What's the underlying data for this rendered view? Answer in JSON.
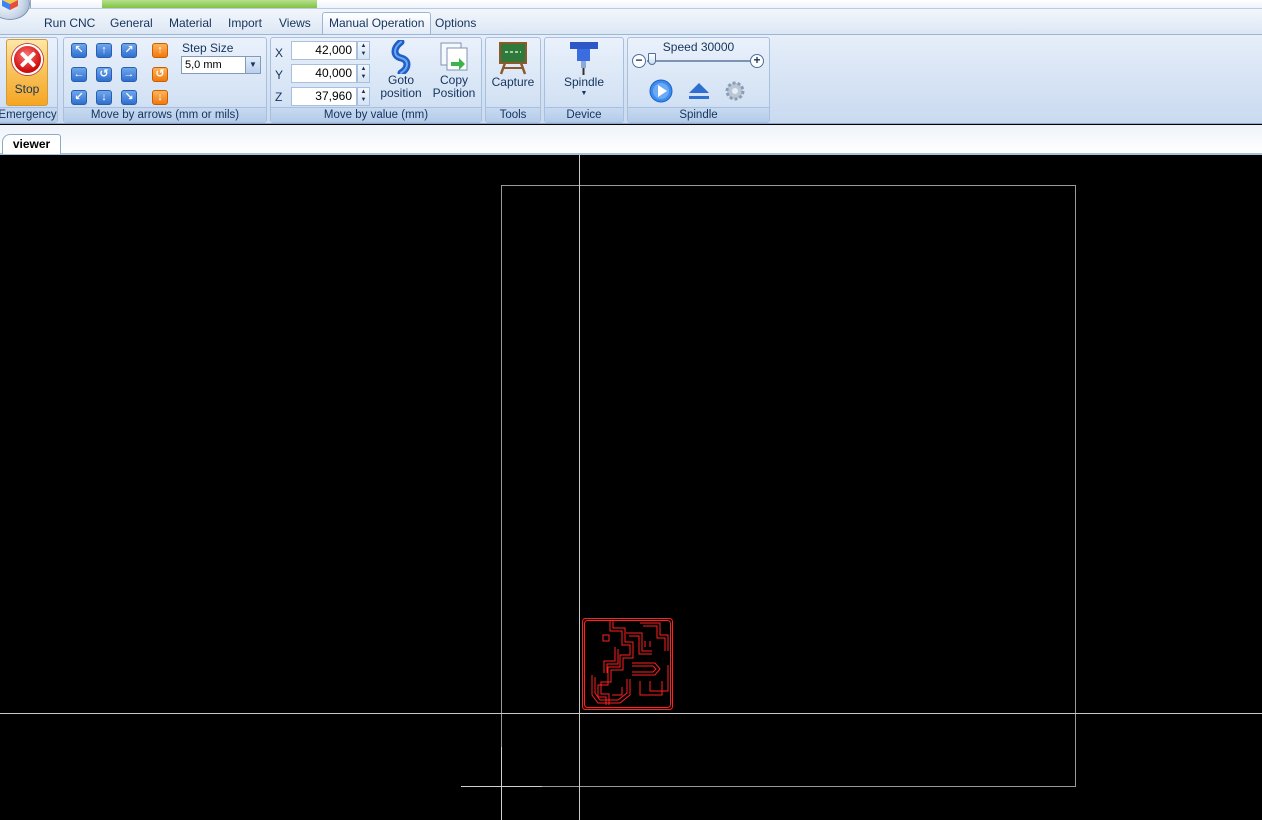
{
  "menu": {
    "tabs": [
      "Run CNC",
      "General",
      "Material",
      "Import",
      "Views",
      "Manual Operation",
      "Options"
    ],
    "active": "Manual Operation"
  },
  "ribbon": {
    "emergency": {
      "button_label": "Stop",
      "group_label": "Emergency"
    },
    "arrows": {
      "group_label": "Move by arrows (mm or mils)",
      "step_size_label": "Step Size",
      "step_size_value": "5,0 mm"
    },
    "move_value": {
      "group_label": "Move by value (mm)",
      "x_label": "X",
      "x_value": "42,000",
      "y_label": "Y",
      "y_value": "40,000",
      "z_label": "Z",
      "z_value": "37,960",
      "goto_label_1": "Goto",
      "goto_label_2": "position",
      "copy_label_1": "Copy",
      "copy_label_2": "Position"
    },
    "tools": {
      "group_label": "Tools",
      "capture_label": "Capture"
    },
    "device": {
      "group_label": "Device",
      "spindle_label": "Spindle"
    },
    "spindle": {
      "group_label": "Spindle",
      "speed_label": "Speed 30000",
      "speed_level": 0.05
    }
  },
  "document_tabs": {
    "active": "viewer"
  },
  "colors": {
    "toolpath": "#ff2020",
    "guide_lines": "#c8c8c8",
    "accent": "#2f6fcf",
    "emergency": "#f5a623"
  }
}
